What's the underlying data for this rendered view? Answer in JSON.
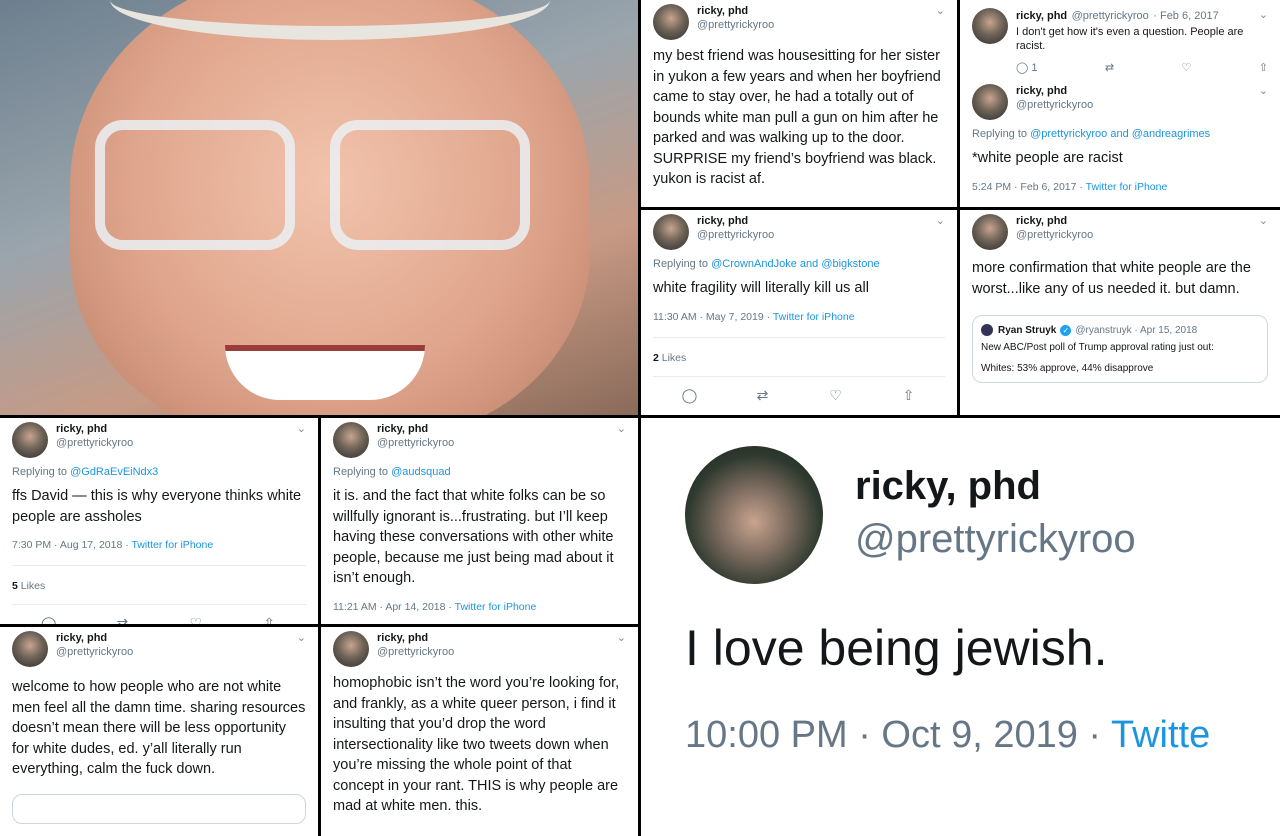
{
  "tweets": {
    "t1": {
      "name": "ricky, phd",
      "handle": "@prettyrickyroo",
      "text": "my best friend was housesitting for her sister in yukon a few years and when her boyfriend came to stay over, he had a totally out of bounds white man pull a gun on him after he parked and was walking up to the door. SURPRISE my friend’s boyfriend was black. yukon is racist af."
    },
    "t2a": {
      "name": "ricky, phd",
      "handle": "@prettyrickyroo",
      "date": "· Feb 6, 2017",
      "text": "I don't get how it's even a question. People are racist.",
      "reply_count": "1"
    },
    "t2b": {
      "name": "ricky, phd",
      "handle": "@prettyrickyroo",
      "replying": "Replying to ",
      "reply_to": "@prettyrickyroo and @andreagrimes",
      "text": "*white people are racist",
      "time": "5:24 PM · Feb 6, 2017 · ",
      "source": "Twitter for iPhone"
    },
    "t3": {
      "name": "ricky, phd",
      "handle": "@prettyrickyroo",
      "replying": "Replying to ",
      "reply_to": "@CrownAndJoke and @bigkstone",
      "text": "white fragility will literally kill us all",
      "time": "11:30 AM · May 7, 2019 · ",
      "source": "Twitter for iPhone",
      "likes_count": "2",
      "likes_label": " Likes"
    },
    "t4": {
      "name": "ricky, phd",
      "handle": "@prettyrickyroo",
      "text": "more confirmation that white people are the worst...like any of us needed it. but damn.",
      "quote_name": "Ryan Struyk",
      "quote_handle": "@ryanstruyk · Apr 15, 2018",
      "quote_text": "New ABC/Post poll of Trump approval rating just out:",
      "quote_text2": "Whites: 53% approve, 44% disapprove"
    },
    "t5": {
      "name": "ricky, phd",
      "handle": "@prettyrickyroo",
      "replying": "Replying to ",
      "reply_to": "@GdRaEvEiNdx3",
      "text": "ffs David — this is why everyone thinks white people are assholes",
      "time": "7:30 PM · Aug 17, 2018 · ",
      "source": "Twitter for iPhone",
      "likes_count": "5",
      "likes_label": " Likes"
    },
    "t6": {
      "name": "ricky, phd",
      "handle": "@prettyrickyroo",
      "replying": "Replying to ",
      "reply_to": "@audsquad",
      "text": "it is. and the fact that white folks can be so willfully ignorant is...frustrating. but I’ll keep having these conversations with other white people, because me just being mad about it isn’t enough.",
      "time": "11:21 AM · Apr 14, 2018 · ",
      "source": "Twitter for iPhone"
    },
    "t7": {
      "name": "ricky, phd",
      "handle": "@prettyrickyroo",
      "text": "welcome to how people who are not white men feel all the damn time. sharing resources doesn’t mean there will be less opportunity for white dudes, ed. y’all literally run everything, calm the fuck down."
    },
    "t8": {
      "name": "ricky, phd",
      "handle": "@prettyrickyroo",
      "text": "homophobic isn’t the word you’re looking for, and frankly, as a white queer person, i find it insulting that you’d drop the word intersectionality like two tweets down when you’re missing the whole point of that concept in your rant. THIS is why people are mad at white men. this."
    },
    "t9": {
      "name": "ricky, phd",
      "handle": "@prettyrickyroo",
      "text": "I love being jewish.",
      "time": "10:00 PM · Oct 9, 2019 · ",
      "source": "Twitte"
    }
  },
  "icons": {
    "chevron": "⌄",
    "reply": "◯",
    "retweet": "⇄",
    "like": "♡",
    "share": "⇧",
    "verified": "✓"
  }
}
